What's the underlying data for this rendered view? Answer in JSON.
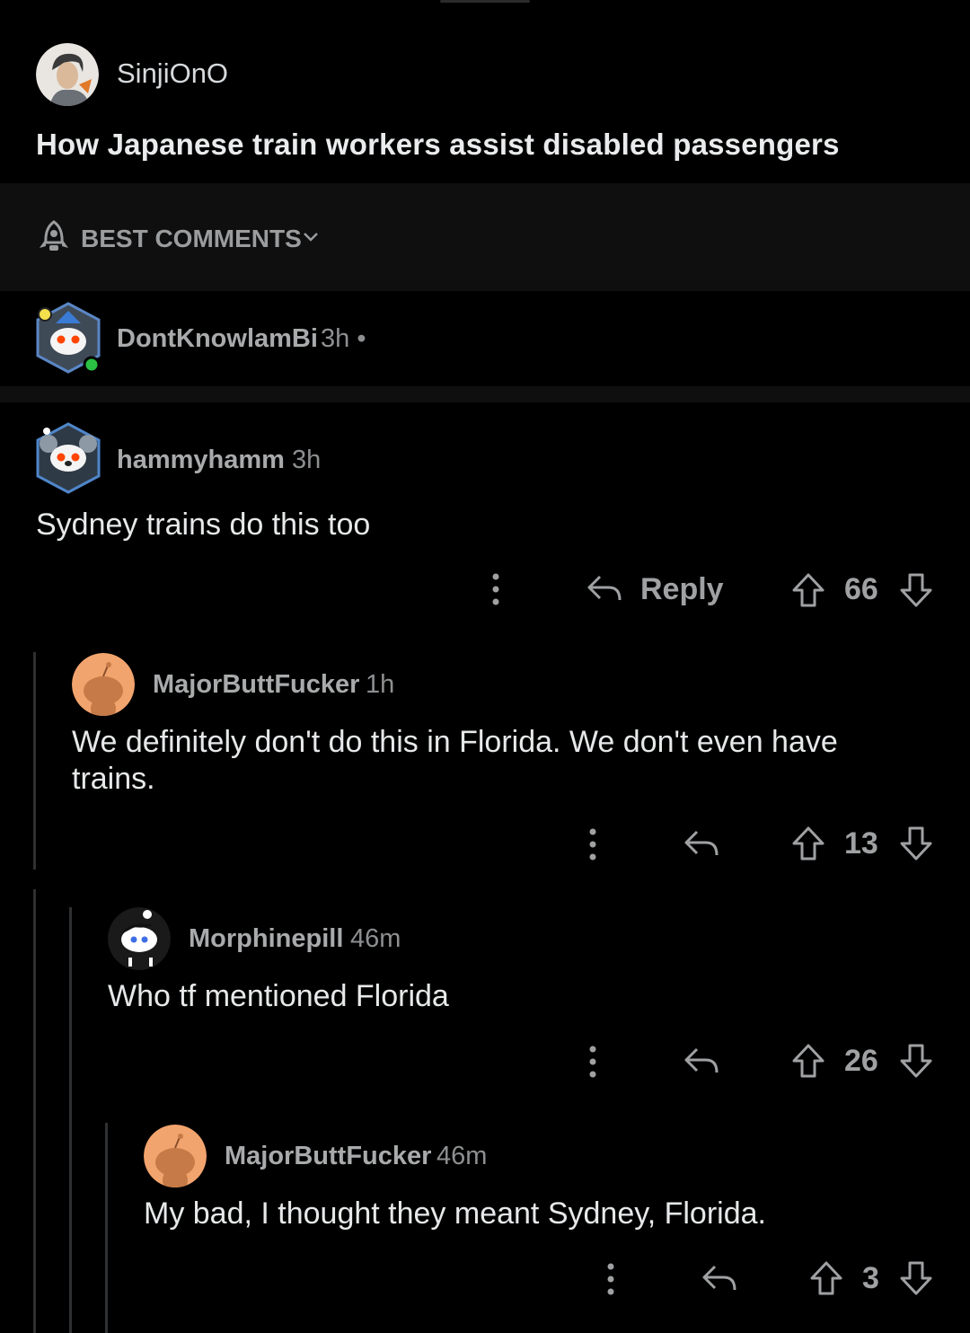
{
  "post": {
    "author": "SinjiOnO",
    "title": "How Japanese train workers assist disabled passengers"
  },
  "sort": {
    "label": "BEST COMMENTS"
  },
  "collapsed_comment": {
    "username": "DontKnowlamBi",
    "time": "3h •"
  },
  "comments": [
    {
      "username": "hammyhamm",
      "time": "3h",
      "body": "Sydney trains do this too",
      "reply_label": "Reply",
      "score": "66"
    },
    {
      "username": "MajorButtFucker",
      "time": "1h",
      "body_line1": "We definitely don't do this in Florida. We don't even have",
      "body_line2": "trains.",
      "score": "13"
    },
    {
      "username": "Morphinepill",
      "time": "46m",
      "body": "Who tf mentioned Florida",
      "score": "26"
    },
    {
      "username": "MajorButtFucker",
      "time": "46m",
      "body": "My bad, I thought they meant Sydney, Florida.",
      "score": "3"
    }
  ],
  "colors": {
    "background": "#000000",
    "upvote_icon": "#9fa1a3",
    "thread_line": "#2f3031"
  }
}
